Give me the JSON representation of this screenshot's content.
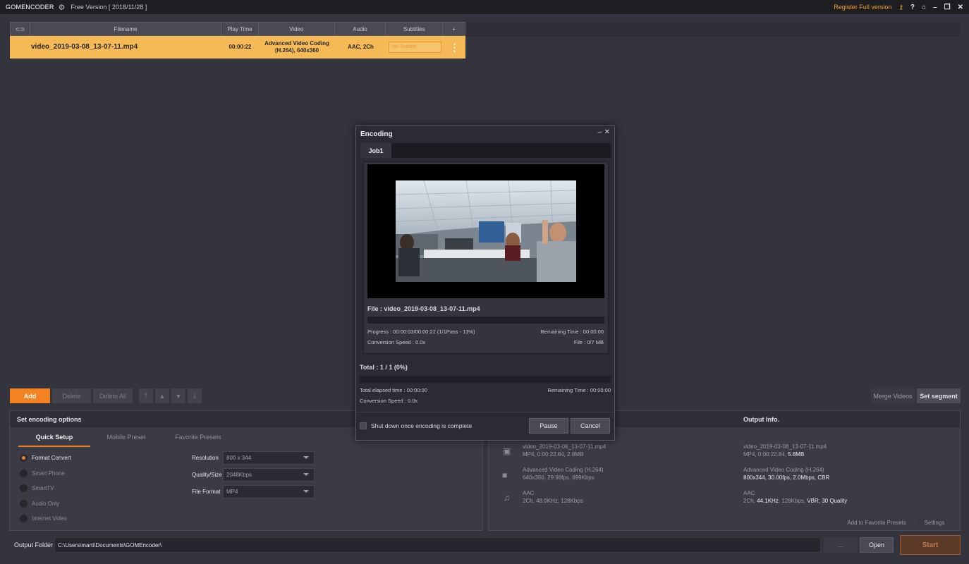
{
  "titlebar": {
    "logo_bold": "GOM",
    "logo_rest": "ENCODER",
    "version": "Free Version   [ 2018/11/28 ]",
    "register": "Register Full version"
  },
  "table": {
    "headers": [
      "Filename",
      "Play Time",
      "Video",
      "Audio",
      "Subtitles",
      "+"
    ],
    "row": {
      "filename": "video_2019-03-08_13-07-11.mp4",
      "playtime": "00:00:22",
      "video_line1": "Advanced Video Coding",
      "video_line2": "(H.264), 640x360",
      "audio": "AAC, 2Ch",
      "subtitle": "No Subtitle"
    }
  },
  "toolbar": {
    "add": "Add",
    "delete": "Delete",
    "delete_all": "Delete All",
    "merge": "Merge Videos",
    "segment": "Set segment"
  },
  "options": {
    "title": "Set encoding options",
    "tabs": [
      "Quick Setup",
      "Mobile Preset",
      "Favorite Presets"
    ],
    "radios": [
      "Format Convert",
      "Smart Phone",
      "SmartTV",
      "Audio Only",
      "Internet Video"
    ],
    "resolution_label": "Resolution",
    "resolution_value": "800 x 344",
    "quality_label": "Quality/Size",
    "quality_value": "2048Kbps",
    "format_label": "File Format",
    "format_value": "MP4"
  },
  "info": {
    "output_title": "Output Info.",
    "input_file": "video_2019-03-08_13-07-11.mp4",
    "input_file_meta": "MP4, 0:00:22.84, 2.8MB",
    "input_video": "Advanced Video Coding (H.264)",
    "input_video_meta": "640x360, 29.98fps, 899Kbps",
    "input_audio": "AAC",
    "input_audio_meta": "2Ch, 48.0KHz, 128Kbps",
    "output_file": "video_2019-03-08_13-07-11.mp4",
    "output_file_meta_a": "MP4, 0:00:22.84, ",
    "output_file_meta_b": "5.8MB",
    "output_video": "Advanced Video Coding (H.264)",
    "output_video_meta": "800x344, 30.00fps, 2.0Mbps, CBR",
    "output_audio": "AAC",
    "output_audio_meta_a": "2Ch, ",
    "output_audio_meta_b": "44.1KHz",
    "output_audio_meta_c": ", 128Kbps, ",
    "output_audio_meta_d": "VBR, 30 Quality",
    "add_fav": "Add to Favorite Presets",
    "settings": "Settings"
  },
  "output": {
    "label": "Output Folder",
    "path": "C:\\Users\\marti\\Documents\\GOMEncoder\\",
    "browse": "...",
    "open": "Open",
    "start": "Start"
  },
  "dialog": {
    "title": "Encoding",
    "minimize": "–",
    "close": "✕",
    "job_tab": "Job1",
    "file": "File : video_2019-03-08_13-07-11.mp4",
    "progress": "Progress : 00:00:03/00:00:22 (1/1Pass - 13%)",
    "remaining": "Remaining Time : 00:00:00",
    "speed": "Conversion Speed : 0.0x",
    "filesize": "File : 0/7 MB",
    "total": "Total : 1 / 1 (0%)",
    "elapsed": "Total elapsed time : 00:00:00",
    "total_remaining": "Remaining Time : 00:00:00",
    "total_speed": "Conversion Speed : 0.0x",
    "shutdown": "Shut down once encoding is complete",
    "pause": "Pause",
    "cancel": "Cancel"
  },
  "colors": {
    "accent": "#f58220",
    "row_highlight": "#f5b956",
    "background": "#34343e"
  }
}
